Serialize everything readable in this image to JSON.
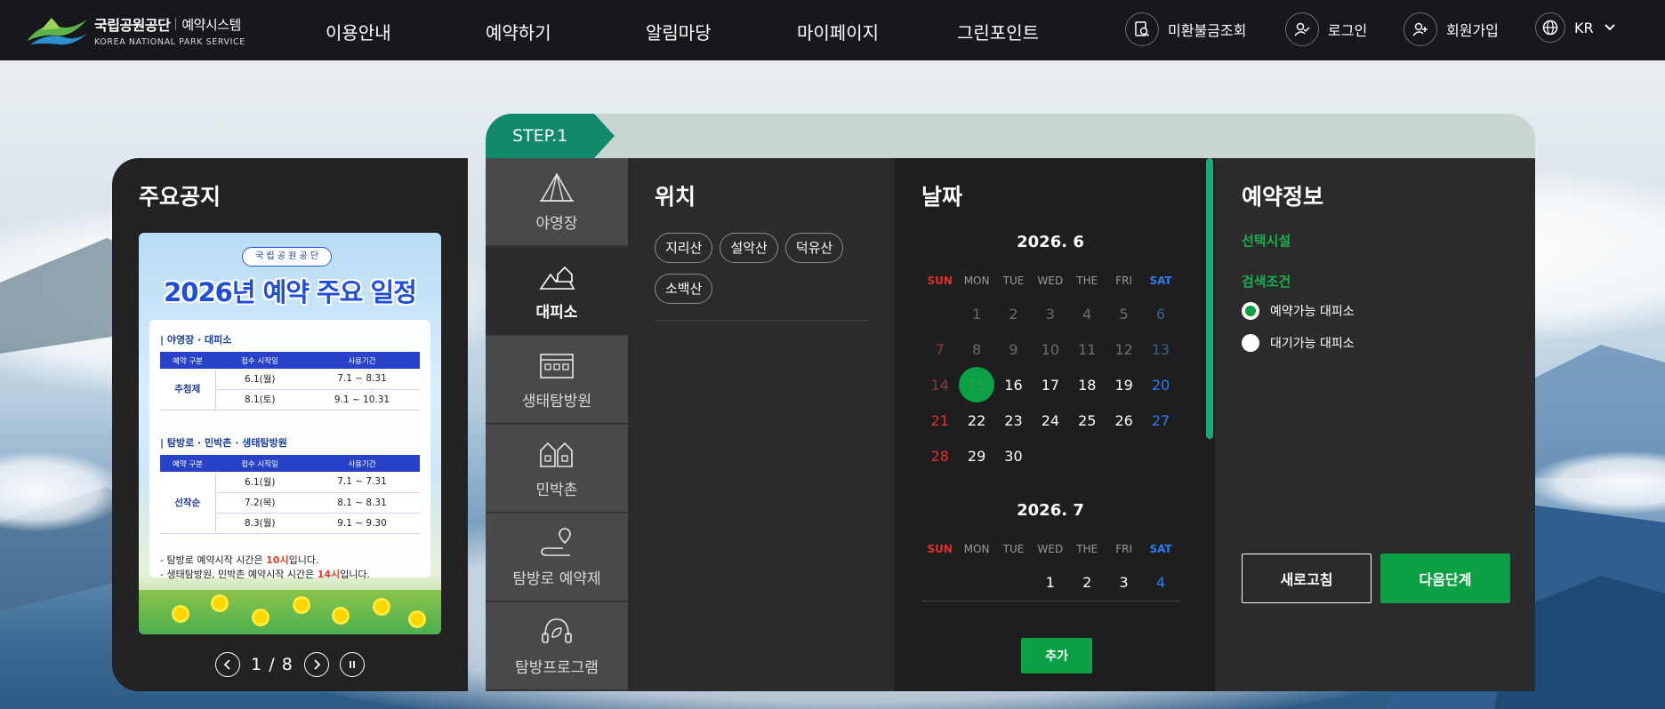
{
  "header": {
    "logo_ko": "국립공원공단",
    "logo_sub": "예약시스템",
    "logo_en": "KOREA NATIONAL PARK SERVICE",
    "nav": [
      "이용안내",
      "예약하기",
      "알림마당",
      "마이페이지",
      "그린포인트"
    ],
    "util": {
      "refund": "미환불금조회",
      "login": "로그인",
      "signup": "회원가입",
      "lang": "KR"
    }
  },
  "notice": {
    "title": "주요공지",
    "poster": {
      "badge": "국 립 공 원 공 단",
      "headline": "2026년 예약 주요 일정",
      "section1": "| 야영장 · 대피소",
      "section2": "| 탐방로 · 민박촌 · 생태탐방원",
      "headers": [
        "예약 구분",
        "접수 시작일",
        "사용기간"
      ],
      "table1": {
        "group": "추첨제",
        "rows": [
          [
            "6.1(월)",
            "7.1 ~ 8.31"
          ],
          [
            "8.1(토)",
            "9.1 ~ 10.31"
          ]
        ]
      },
      "table2": {
        "group": "선착순",
        "rows": [
          [
            "6.1(월)",
            "7.1 ~ 7.31"
          ],
          [
            "7.2(목)",
            "8.1 ~ 8.31"
          ],
          [
            "8.3(월)",
            "9.1 ~ 9.30"
          ]
        ]
      },
      "note1_pre": "- 탐방로 예약시작 시간은 ",
      "note1_hl": "10시",
      "note1_post": "입니다.",
      "note2_pre": "- 생태탐방원, 민박촌 예약시작 시간은 ",
      "note2_hl": "14시",
      "note2_post": "입니다."
    },
    "pager": {
      "current": "1",
      "sep": "/",
      "total": "8"
    }
  },
  "step": {
    "label": "STEP.1",
    "categories": [
      {
        "label": "야영장",
        "icon": "tent-icon",
        "active": false
      },
      {
        "label": "대피소",
        "icon": "mountain-shelter-icon",
        "active": true
      },
      {
        "label": "생태탐방원",
        "icon": "building-icon",
        "active": false
      },
      {
        "label": "민박촌",
        "icon": "houses-icon",
        "active": false
      },
      {
        "label": "탐방로 예약제",
        "icon": "trail-pin-icon",
        "active": false
      },
      {
        "label": "탐방프로그램",
        "icon": "headset-leaf-icon",
        "active": false
      }
    ],
    "location": {
      "title": "위치",
      "chips": [
        "지리산",
        "설악산",
        "덕유산",
        "소백산"
      ]
    },
    "date": {
      "title": "날짜",
      "dow": [
        "SUN",
        "MON",
        "TUE",
        "WED",
        "THE",
        "FRI",
        "SAT"
      ],
      "months": [
        {
          "title": "2026. 6",
          "offset": 1,
          "days": 30,
          "dim_until": 14,
          "selected": 15
        },
        {
          "title": "2026. 7",
          "offset": 3,
          "days": 4,
          "dim_until": 0,
          "selected": 0
        }
      ],
      "add_label": "추가"
    },
    "info": {
      "title": "예약정보",
      "selected_facility": "선택시설",
      "search_condition": "검색조건",
      "options": [
        {
          "label": "예약가능 대피소",
          "checked": true
        },
        {
          "label": "대기가능 대피소",
          "checked": false
        }
      ],
      "refresh_label": "새로고침",
      "next_label": "다음단계"
    }
  },
  "colors": {
    "accent_green": "#0aa043",
    "step_teal": "#108a6a",
    "header_bg": "#16181b"
  }
}
